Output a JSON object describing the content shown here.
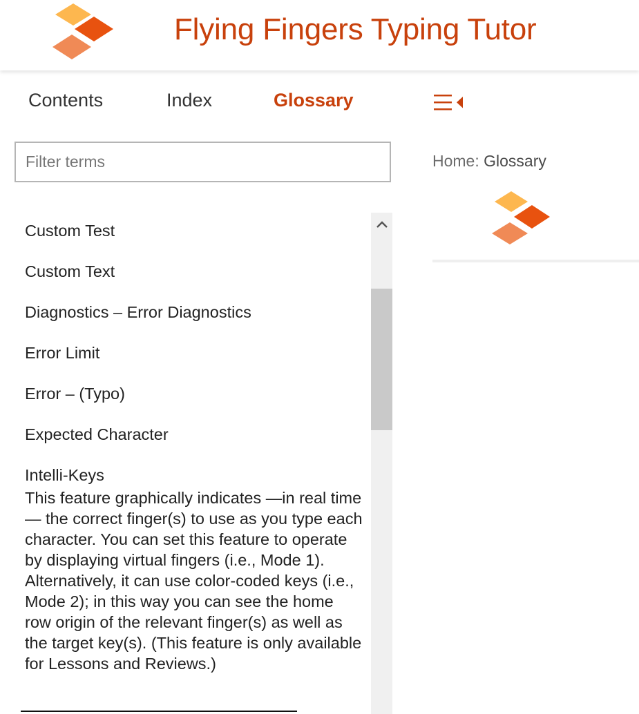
{
  "header": {
    "title": "Flying Fingers Typing Tutor",
    "logo_icon": "flying-fingers-logo",
    "colors": {
      "brand": "#c8410c",
      "logo_yellow": "#fdb74f",
      "logo_orange": "#e8520f",
      "logo_salmon": "#f08a56"
    }
  },
  "nav": {
    "tabs": [
      {
        "label": "Contents",
        "active": false
      },
      {
        "label": "Index",
        "active": false
      },
      {
        "label": "Glossary",
        "active": true
      }
    ],
    "toggle_icon": "collapse-sidebar-icon"
  },
  "filter": {
    "placeholder": "Filter terms",
    "value": ""
  },
  "glossary": {
    "terms": [
      {
        "label": "Custom Test"
      },
      {
        "label": "Custom Text"
      },
      {
        "label": "Diagnostics – Error Diagnostics"
      },
      {
        "label": "Error Limit"
      },
      {
        "label": "Error – (Typo)"
      },
      {
        "label": "Expected Character"
      },
      {
        "label": "Intelli-Keys",
        "expanded": true,
        "definition": "This feature graphically indicates —in real time— the correct finger(s) to use as you type each character. You can set this feature to operate by displaying virtual fingers (i.e., Mode 1). Alternatively, it can use color-coded keys (i.e., Mode 2); in this way you can see the home row origin of the relevant finger(s) as well as the target key(s). (This feature is only available for Lessons and Reviews.)"
      }
    ]
  },
  "scrollbar": {
    "up_icon": "chevron-up-icon"
  },
  "breadcrumb": {
    "home": "Home",
    "separator": ": ",
    "current": "Glossary"
  }
}
